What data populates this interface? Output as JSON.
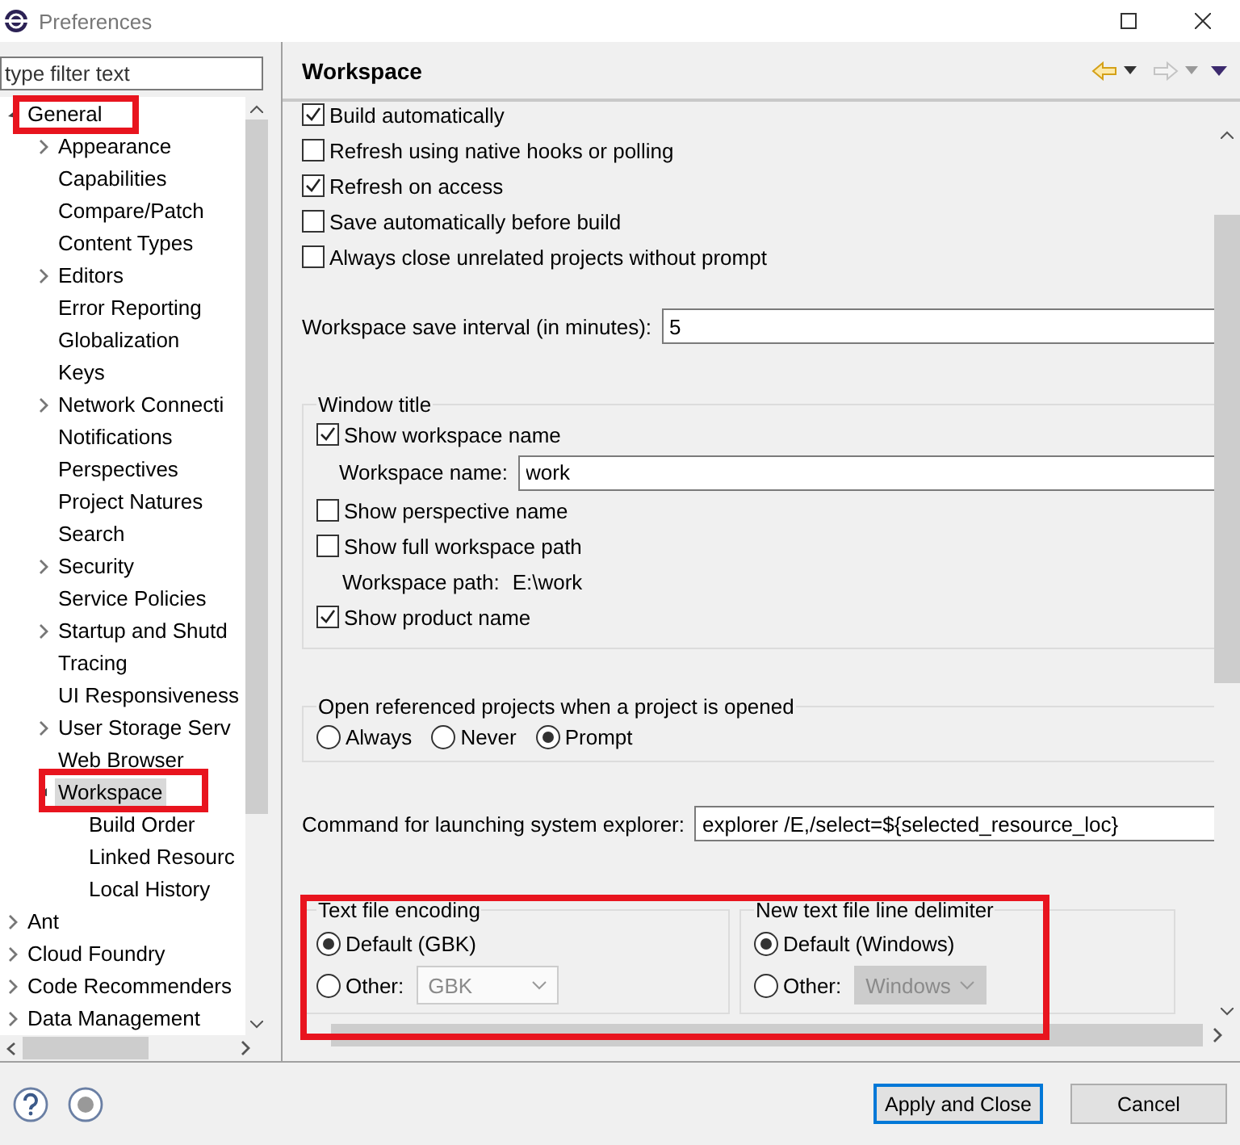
{
  "window": {
    "title": "Preferences"
  },
  "filter": {
    "placeholder": "type filter text"
  },
  "tree": [
    {
      "label": "General",
      "expanded": true,
      "selected": false,
      "children": [
        {
          "label": "Appearance",
          "expanded": false,
          "selected": false
        },
        {
          "label": "Capabilities",
          "selected": false
        },
        {
          "label": "Compare/Patch",
          "selected": false
        },
        {
          "label": "Content Types",
          "selected": false
        },
        {
          "label": "Editors",
          "expanded": false,
          "selected": false
        },
        {
          "label": "Error Reporting",
          "selected": false
        },
        {
          "label": "Globalization",
          "selected": false
        },
        {
          "label": "Keys",
          "selected": false
        },
        {
          "label": "Network Connecti",
          "expanded": false,
          "selected": false
        },
        {
          "label": "Notifications",
          "selected": false
        },
        {
          "label": "Perspectives",
          "selected": false
        },
        {
          "label": "Project Natures",
          "selected": false
        },
        {
          "label": "Search",
          "selected": false
        },
        {
          "label": "Security",
          "expanded": false,
          "selected": false
        },
        {
          "label": "Service Policies",
          "selected": false
        },
        {
          "label": "Startup and Shutd",
          "expanded": false,
          "selected": false
        },
        {
          "label": "Tracing",
          "selected": false
        },
        {
          "label": "UI Responsiveness",
          "selected": false
        },
        {
          "label": "User Storage Serv",
          "expanded": false,
          "selected": false
        },
        {
          "label": "Web Browser",
          "selected": false
        },
        {
          "label": "Workspace",
          "expanded": true,
          "selected": true,
          "children": [
            {
              "label": "Build Order",
              "selected": false
            },
            {
              "label": "Linked Resourc",
              "selected": false
            },
            {
              "label": "Local History",
              "selected": false
            }
          ]
        }
      ]
    },
    {
      "label": "Ant",
      "expanded": false,
      "selected": false
    },
    {
      "label": "Cloud Foundry",
      "expanded": false,
      "selected": false
    },
    {
      "label": "Code Recommenders",
      "expanded": false,
      "selected": false
    },
    {
      "label": "Data Management",
      "expanded": false,
      "selected": false
    }
  ],
  "page": {
    "title": "Workspace",
    "options": [
      {
        "label": "Build automatically",
        "checked": true
      },
      {
        "label": "Refresh using native hooks or polling",
        "checked": false
      },
      {
        "label": "Refresh on access",
        "checked": true
      },
      {
        "label": "Save automatically before build",
        "checked": false
      },
      {
        "label": "Always close unrelated projects without prompt",
        "checked": false
      }
    ],
    "save_interval": {
      "label": "Workspace save interval (in minutes):",
      "value": "5"
    },
    "window_title": {
      "title": "Window title",
      "items": [
        {
          "kind": "checkbox",
          "label": "Show workspace name",
          "checked": true
        },
        {
          "kind": "field",
          "label": "Workspace name:",
          "value": "work"
        },
        {
          "kind": "checkbox",
          "label": "Show perspective name",
          "checked": false
        },
        {
          "kind": "checkbox",
          "label": "Show full workspace path",
          "checked": false
        },
        {
          "kind": "path",
          "label": "Workspace path:",
          "value": "E:\\work"
        },
        {
          "kind": "checkbox",
          "label": "Show product name",
          "checked": true
        }
      ]
    },
    "open_referenced": {
      "title": "Open referenced projects when a project is opened",
      "options": [
        {
          "label": "Always",
          "selected": false
        },
        {
          "label": "Never",
          "selected": false
        },
        {
          "label": "Prompt",
          "selected": true
        }
      ]
    },
    "explorer_command": {
      "label": "Command for launching system explorer:",
      "value": "explorer /E,/select=${selected_resource_loc}"
    },
    "encoding": {
      "title": "Text file encoding",
      "options": [
        {
          "label": "Default (GBK)",
          "selected": true
        },
        {
          "label": "Other:",
          "selected": false
        }
      ],
      "dropdown": {
        "value": "GBK",
        "disabled": true
      }
    },
    "delimiter": {
      "title": "New text file line delimiter",
      "options": [
        {
          "label": "Default (Windows)",
          "selected": true
        },
        {
          "label": "Other:",
          "selected": false
        }
      ],
      "dropdown": {
        "value": "Windows",
        "disabled": true
      }
    }
  },
  "buttons": [
    {
      "label": "Apply and Close",
      "default": true
    },
    {
      "label": "Cancel",
      "default": false
    }
  ]
}
